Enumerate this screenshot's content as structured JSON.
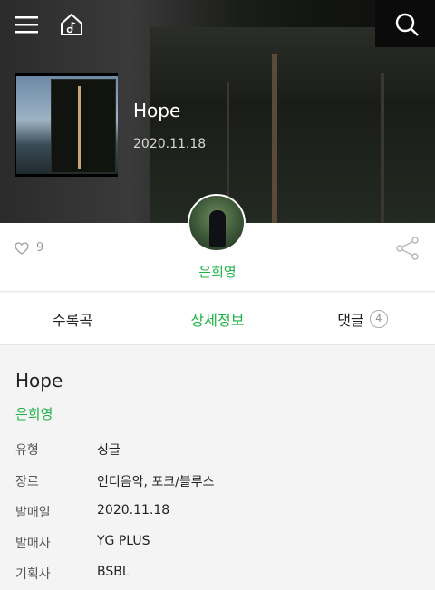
{
  "header": {
    "menu_icon": "hamburger-menu-icon",
    "home_icon": "music-home-icon",
    "search_icon": "search-icon"
  },
  "album": {
    "title": "Hope",
    "release_date": "2020.11.18",
    "artist": "은희영",
    "like_count": "9"
  },
  "tabs": [
    {
      "label": "수록곡"
    },
    {
      "label": "상세정보"
    },
    {
      "label": "댓글",
      "badge": "4"
    }
  ],
  "details": {
    "title": "Hope",
    "artist": "은희영",
    "rows": [
      {
        "key": "유형",
        "value": "싱글"
      },
      {
        "key": "장르",
        "value": "인디음악, 포크/블루스"
      },
      {
        "key": "발매일",
        "value": "2020.11.18"
      },
      {
        "key": "발매사",
        "value": "YG PLUS"
      },
      {
        "key": "기획사",
        "value": "BSBL"
      }
    ]
  },
  "colors": {
    "accent": "#1eb347"
  }
}
